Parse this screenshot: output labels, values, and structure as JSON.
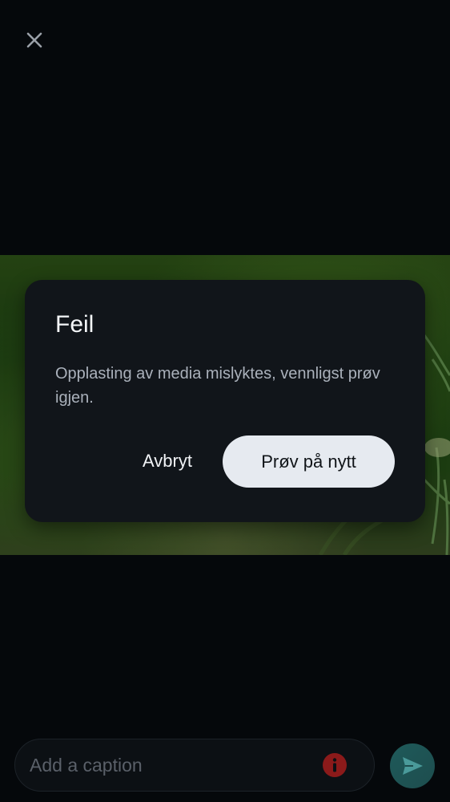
{
  "dialog": {
    "title": "Feil",
    "message": "Opplasting av media mislyktes, vennligst prøv igjen.",
    "cancel_label": "Avbryt",
    "retry_label": "Prøv på nytt"
  },
  "caption": {
    "placeholder": "Add a caption"
  },
  "icons": {
    "close": "close-icon",
    "error": "error-info-icon",
    "send": "send-icon"
  },
  "colors": {
    "background": "#05080b",
    "dialog_bg": "#11151a",
    "primary_button_bg": "#e6eaf0",
    "error_red": "#8b1a1a",
    "send_button": "#1f5a5a"
  }
}
